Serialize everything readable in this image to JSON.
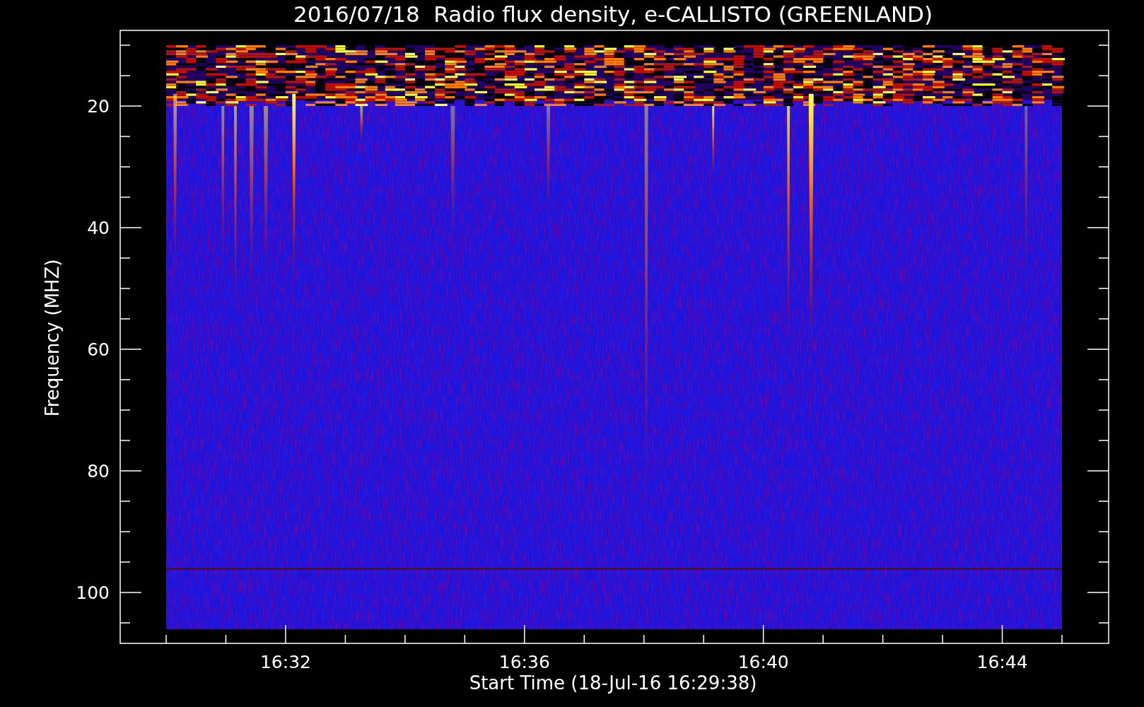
{
  "title": "2016/07/18  Radio flux density, e-CALLISTO (GREENLAND)",
  "x_axis": {
    "label": "Start Time (18-Jul-16 16:29:38)",
    "ticks": [
      "16:32",
      "16:36",
      "16:40",
      "16:44"
    ]
  },
  "y_axis": {
    "label": "Frequency (MHZ)",
    "ticks": [
      "20",
      "40",
      "60",
      "80",
      "100"
    ]
  }
}
